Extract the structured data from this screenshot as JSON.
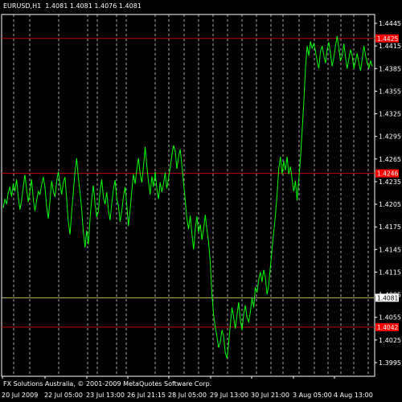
{
  "header": {
    "symbol_info": "EURUSD,H1  1.4081 1.4081 1.4076 1.4081"
  },
  "footer": {
    "copyright": "FX Solutions Australia, © 2001-2009 MetaQuotes Software Corp."
  },
  "colors": {
    "background": "#000000",
    "price_line": "#00ff00",
    "level_line": "#c00000",
    "level_badge": "#ff0000",
    "current_line": "#b8b85a",
    "current_badge": "#ffffff",
    "grid": "#ffffff",
    "axis_text": "#ffffff"
  },
  "chart_data": {
    "type": "line",
    "symbol": "EURUSD",
    "timeframe": "H1",
    "ylim": [
      1.3995,
      1.446
    ],
    "y_ticks": [
      "1.4445",
      "1.4415",
      "1.4385",
      "1.4355",
      "1.4325",
      "1.4295",
      "1.4265",
      "1.4235",
      "1.4205",
      "1.4175",
      "1.4145",
      "1.4115",
      "1.4085",
      "1.4055",
      "1.4025",
      "1.3995"
    ],
    "x_ticks": [
      "20 Jul 2009",
      "22 Jul 05:00",
      "23 Jul 13:00",
      "26 Jul 21:15",
      "28 Jul 05:00",
      "29 Jul 13:00",
      "30 Jul 21:00",
      "3 Aug 05:00",
      "4 Aug 13:00"
    ],
    "grid": true,
    "levels": [
      {
        "label": "1.4425",
        "value": 1.4425
      },
      {
        "label": "1.4246",
        "value": 1.4246
      },
      {
        "label": "1.4042",
        "value": 1.4042
      }
    ],
    "current_price": {
      "label": "1.4081",
      "value": 1.4081
    },
    "series": [
      {
        "values": [
          1.42,
          1.4212,
          1.4205,
          1.422,
          1.4228,
          1.4215,
          1.4232,
          1.4222,
          1.4238,
          1.4215,
          1.4198,
          1.421,
          1.4228,
          1.4244,
          1.4225,
          1.4208,
          1.4222,
          1.4238,
          1.4212,
          1.4196,
          1.421,
          1.4222,
          1.4218,
          1.4231,
          1.4241,
          1.4228,
          1.4202,
          1.4186,
          1.421,
          1.4236,
          1.4222,
          1.4215,
          1.4235,
          1.4248,
          1.4232,
          1.4218,
          1.4234,
          1.4241,
          1.4212,
          1.4181,
          1.4165,
          1.4195,
          1.4221,
          1.4248,
          1.4266,
          1.424,
          1.4221,
          1.4198,
          1.4168,
          1.4148,
          1.417,
          1.4152,
          1.4186,
          1.4212,
          1.423,
          1.4205,
          1.4188,
          1.4196,
          1.4222,
          1.4238,
          1.4214,
          1.4205,
          1.4221,
          1.4197,
          1.4184,
          1.4206,
          1.4225,
          1.4237,
          1.4212,
          1.4203,
          1.4182,
          1.4196,
          1.4215,
          1.4228,
          1.4204,
          1.4176,
          1.4198,
          1.4222,
          1.4245,
          1.4232,
          1.4251,
          1.4266,
          1.4245,
          1.4234,
          1.4255,
          1.4281,
          1.4256,
          1.4235,
          1.4218,
          1.4242,
          1.4228,
          1.4248,
          1.4225,
          1.4212,
          1.4234,
          1.4221,
          1.4232,
          1.4247,
          1.4226,
          1.424,
          1.4253,
          1.427,
          1.4283,
          1.4276,
          1.4252,
          1.4268,
          1.4278,
          1.4256,
          1.4233,
          1.4211,
          1.4186,
          1.4172,
          1.419,
          1.4166,
          1.4145,
          1.4172,
          1.4189,
          1.4168,
          1.4178,
          1.4158,
          1.4172,
          1.4191,
          1.4171,
          1.4155,
          1.4128,
          1.4085,
          1.4058,
          1.4042,
          1.403,
          1.4015,
          1.4022,
          1.4038,
          1.403,
          1.4008,
          1.4001,
          1.402,
          1.4045,
          1.4068,
          1.4055,
          1.404,
          1.4058,
          1.4075,
          1.4052,
          1.4038,
          1.4059,
          1.4071,
          1.4055,
          1.4049,
          1.4062,
          1.4081,
          1.4068,
          1.4095,
          1.4088,
          1.4105,
          1.4115,
          1.4102,
          1.4118,
          1.4108,
          1.4085,
          1.4098,
          1.4122,
          1.4145,
          1.4168,
          1.419,
          1.4218,
          1.4252,
          1.4268,
          1.4245,
          1.4262,
          1.425,
          1.4268,
          1.4245,
          1.4255,
          1.4238,
          1.4222,
          1.4236,
          1.421,
          1.4238,
          1.4265,
          1.4302,
          1.434,
          1.4385,
          1.4415,
          1.4402,
          1.4421,
          1.4412,
          1.4418,
          1.4408,
          1.4395,
          1.4385,
          1.4408,
          1.4415,
          1.4402,
          1.4392,
          1.441,
          1.442,
          1.4405,
          1.4388,
          1.44,
          1.4415,
          1.4428,
          1.4412,
          1.4395,
          1.4402,
          1.4418,
          1.44,
          1.4385,
          1.4398,
          1.441,
          1.4402,
          1.4385,
          1.4395,
          1.4405,
          1.4392,
          1.4382,
          1.4398,
          1.4415,
          1.4402,
          1.4392,
          1.4386,
          1.4395,
          1.4388
        ]
      }
    ]
  }
}
